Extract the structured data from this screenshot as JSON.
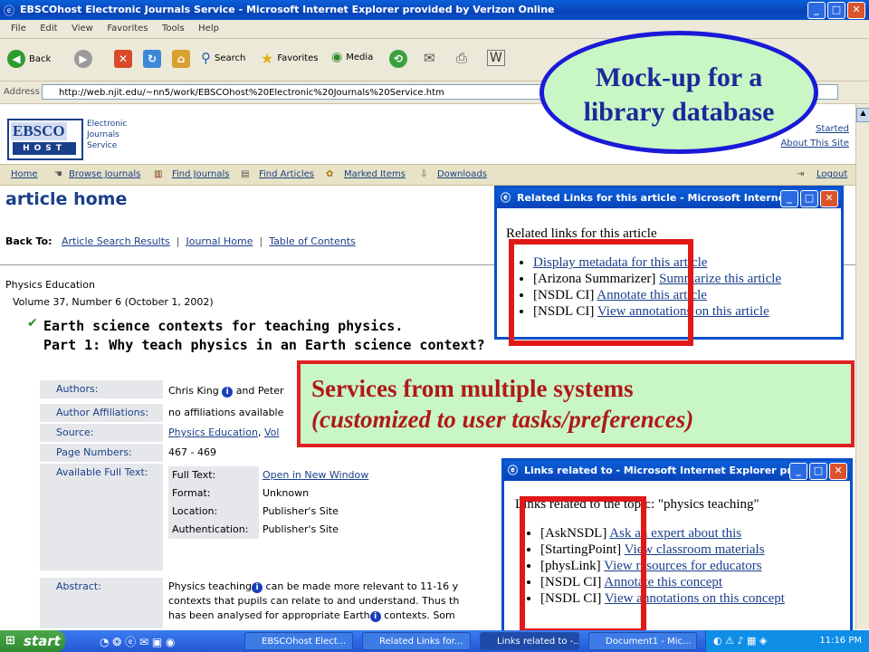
{
  "window": {
    "title": "EBSCOhost Electronic Journals Service - Microsoft Internet Explorer provided by Verizon Online"
  },
  "menu": [
    "File",
    "Edit",
    "View",
    "Favorites",
    "Tools",
    "Help"
  ],
  "toolbar": {
    "back": "Back",
    "search": "Search",
    "favorites": "Favorites",
    "media": "Media"
  },
  "address": {
    "label": "Address",
    "url": "http://web.njit.edu/~nn5/work/EBSCOhost%20Electronic%20Journals%20Service.htm"
  },
  "logo": {
    "top": "EBSCO",
    "bottom": "HOST"
  },
  "service_name": [
    "Electronic",
    "Journals",
    "Service"
  ],
  "top_links": [
    "Started",
    "About This Site"
  ],
  "nav": {
    "items": [
      "Home",
      "Browse Journals",
      "Find Journals",
      "Find Articles",
      "Marked Items",
      "Downloads"
    ],
    "logout": "Logout"
  },
  "page": {
    "title": "article home",
    "back_to_label": "Back To:",
    "back_links": [
      "Article Search Results",
      "Journal Home",
      "Table of Contents"
    ],
    "journal": "Physics Education",
    "volume": "Volume 37, Number 6 (October 1, 2002)",
    "article_title_line1": "Earth science contexts for teaching physics.",
    "article_title_line2": "Part 1: Why teach physics in an Earth science context?",
    "details": {
      "authors_label": "Authors:",
      "authors_value": "Chris King",
      "authors_and": "and Peter",
      "affiliations_label": "Author Affiliations:",
      "affiliations_value": "no affiliations available",
      "source_label": "Source:",
      "source_value": "Physics Education",
      "source_more": "Vol",
      "pages_label": "Page Numbers:",
      "pages_value": "467 - 469",
      "fulltext_label": "Available Full Text:",
      "fulltext_rows": [
        {
          "k": "Full Text:",
          "v": "Open in New Window"
        },
        {
          "k": "Format:",
          "v": "Unknown"
        },
        {
          "k": "Location:",
          "v": "Publisher's Site"
        },
        {
          "k": "Authentication:",
          "v": "Publisher's Site"
        }
      ],
      "abstract_label": "Abstract:",
      "abstract_lines": [
        "Physics teaching",
        "can be made more relevant to 11-16 y",
        "contexts that pupils can relate to and understand. Thus th",
        "has been analysed for appropriate Earth",
        "contexts. Som"
      ]
    }
  },
  "popup1": {
    "title": "Related Links for this article - Microsoft Interne...",
    "heading": "Related links for this article",
    "items": [
      {
        "prefix": "",
        "link": "Display metadata for this article"
      },
      {
        "prefix": "[Arizona Summarizer]",
        "link": "Summarize this article"
      },
      {
        "prefix": "[NSDL CI]",
        "link": "Annotate this article"
      },
      {
        "prefix": "[NSDL CI]",
        "link": "View annotations on this article"
      }
    ]
  },
  "popup2": {
    "title": "Links related to - Microsoft Internet Explorer pr...",
    "heading": "Links related to the topic: \"physics teaching\"",
    "items": [
      {
        "prefix": "[AskNSDL]",
        "link": "Ask an expert about this"
      },
      {
        "prefix": "[StartingPoint]",
        "link": "View classroom materials"
      },
      {
        "prefix": "[physLink]",
        "link": "View resources for educators"
      },
      {
        "prefix": "[NSDL CI]",
        "link": "Annotate this concept"
      },
      {
        "prefix": "[NSDL CI]",
        "link": "View annotations on this concept"
      }
    ]
  },
  "annotations": {
    "bubble_line1": "Mock-up for a",
    "bubble_line2": "library database",
    "services_line1": "Services from multiple systems",
    "services_line2": "(customized to user tasks/preferences)"
  },
  "taskbar": {
    "start": "start",
    "tasks": [
      "EBSCOhost Elect...",
      "Related Links for...",
      "Links related to -...",
      "Document1 - Mic..."
    ],
    "clock": "11:16 PM"
  },
  "colors": {
    "ebsco_blue": "#1a3f8a",
    "annotation_green": "#c8f7c5",
    "annotation_red": "#e01818",
    "xp_blue": "#0a4fc8"
  }
}
